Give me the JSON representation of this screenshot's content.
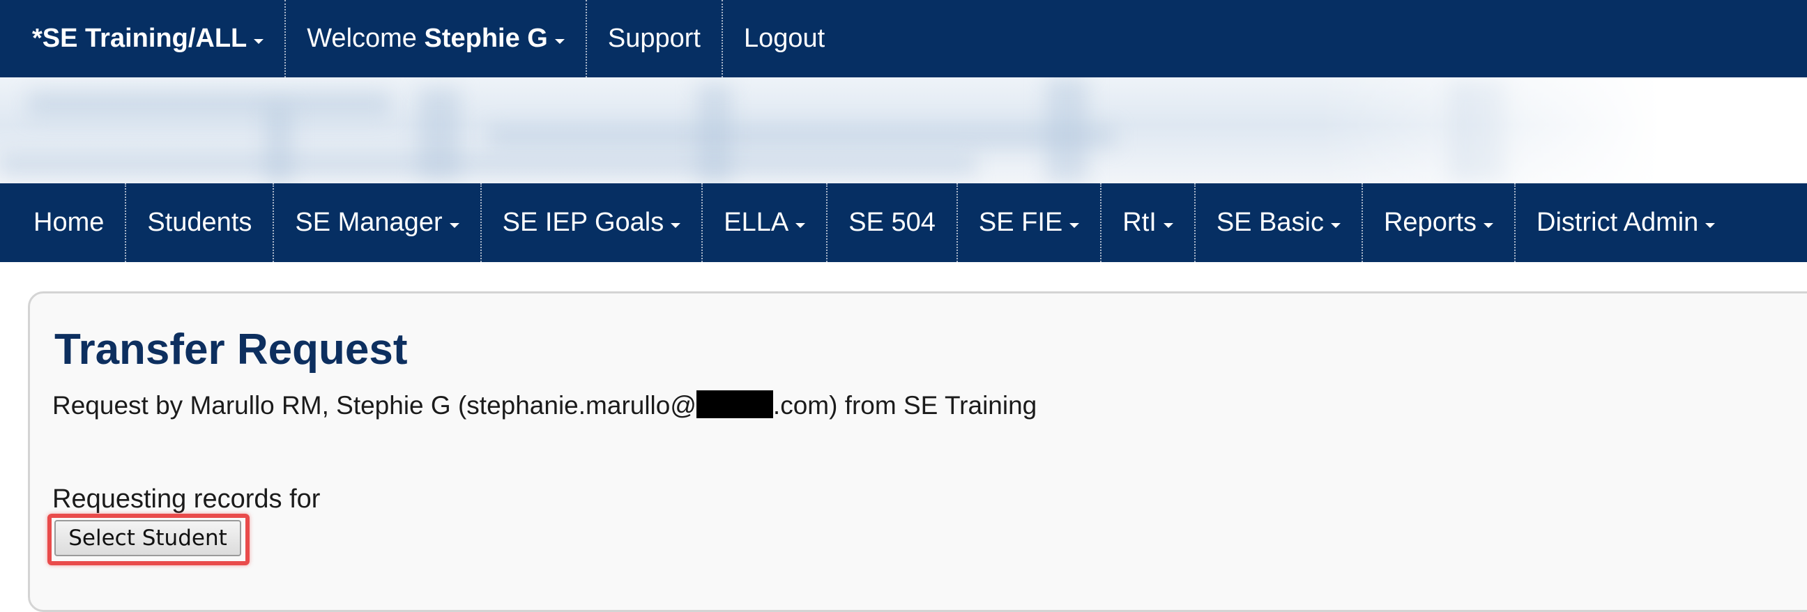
{
  "topbar": {
    "site_label": "*SE Training/ALL",
    "welcome_prefix": "Welcome ",
    "user_name": "Stephie G",
    "support": "Support",
    "logout": "Logout"
  },
  "main_nav": {
    "items": [
      {
        "label": "Home",
        "dropdown": false
      },
      {
        "label": "Students",
        "dropdown": false
      },
      {
        "label": "SE Manager",
        "dropdown": true
      },
      {
        "label": "SE IEP Goals",
        "dropdown": true
      },
      {
        "label": "ELLA",
        "dropdown": true
      },
      {
        "label": "SE 504",
        "dropdown": false
      },
      {
        "label": "SE FIE",
        "dropdown": true
      },
      {
        "label": "RtI",
        "dropdown": true
      },
      {
        "label": "SE Basic",
        "dropdown": true
      },
      {
        "label": "Reports",
        "dropdown": true
      },
      {
        "label": "District Admin",
        "dropdown": true
      }
    ]
  },
  "page": {
    "title": "Transfer Request",
    "request_prefix": "Request by Marullo RM, Stephie G (stephanie.marullo@",
    "request_suffix": ".com) from SE Training",
    "requesting_label": "Requesting records for",
    "select_student_label": "Select Student"
  },
  "colors": {
    "nav_background": "#062f63",
    "title_color": "#0d2f5f",
    "highlight_border": "#e94b4b"
  },
  "icons": {
    "dropdown": "caret-down-icon"
  }
}
